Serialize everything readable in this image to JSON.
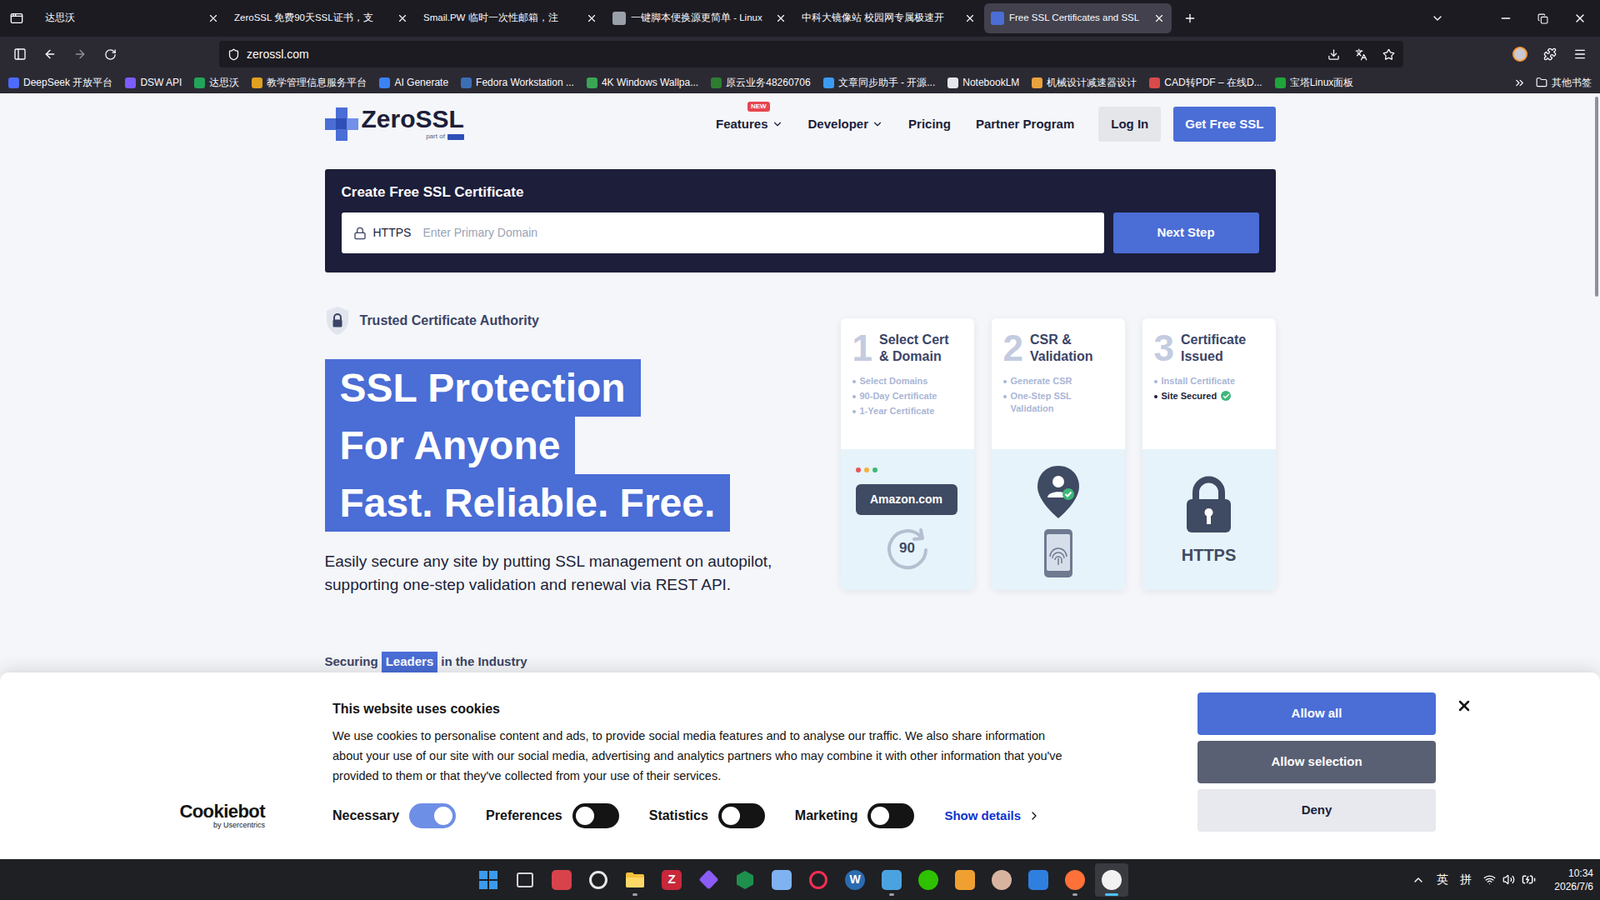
{
  "browser": {
    "tabs": [
      {
        "label": "达思沃",
        "selected": false,
        "has_icon": false
      },
      {
        "label": "ZeroSSL 免费90天SSL证书，支",
        "selected": false,
        "has_icon": false
      },
      {
        "label": "Smail.PW 临时一次性邮箱，注",
        "selected": false,
        "has_icon": false
      },
      {
        "label": "一键脚本便换源更简单 - Linux",
        "selected": false,
        "has_icon": true,
        "color": "#9aa0aa"
      },
      {
        "label": "中科大镜像站 校园网专属极速开",
        "selected": false,
        "has_icon": false
      },
      {
        "label": "Free SSL Certificates and SSL",
        "selected": true,
        "has_icon": true,
        "color": "#4a6dd6"
      }
    ],
    "address": "zerossl.com",
    "bookmarks": [
      {
        "label": "DeepSeek 开放平台",
        "color": "#4d6bfe"
      },
      {
        "label": "DSW API",
        "color": "#7c5cff"
      },
      {
        "label": "达思沃",
        "color": "#22a55a"
      },
      {
        "label": "教学管理信息服务平台",
        "color": "#e0a020"
      },
      {
        "label": "AI Generate",
        "color": "#3b82f6"
      },
      {
        "label": "Fedora Workstation ...",
        "color": "#3c6eb4"
      },
      {
        "label": "4K Windows Wallpa...",
        "color": "#3aa655"
      },
      {
        "label": "原云业务48260706",
        "color": "#2e7d32"
      },
      {
        "label": "文章同步助手 - 开源...",
        "color": "#3b9cf6"
      },
      {
        "label": "NotebookLM",
        "color": "#e5e7eb"
      },
      {
        "label": "机械设计减速器设计",
        "color": "#e8a33d"
      },
      {
        "label": "CAD转PDF – 在线D...",
        "color": "#d94a4a"
      },
      {
        "label": "宝塔Linux面板",
        "color": "#20a53a"
      }
    ],
    "other_bookmarks": "其他书签"
  },
  "page": {
    "logo": {
      "name": "ZeroSSL",
      "tagline": "part of"
    },
    "nav": [
      {
        "label": "Features",
        "badge": "NEW",
        "dropdown": true
      },
      {
        "label": "Developer",
        "dropdown": true
      },
      {
        "label": "Pricing",
        "dropdown": false
      },
      {
        "label": "Partner Program",
        "dropdown": false
      }
    ],
    "login": "Log In",
    "cta": "Get Free SSL",
    "create": {
      "title": "Create Free SSL Certificate",
      "prefix": "HTTPS",
      "placeholder": "Enter Primary Domain",
      "button": "Next Step"
    },
    "trusted": "Trusted Certificate Authority",
    "headline": [
      "SSL Protection",
      "For Anyone",
      "Fast. Reliable. Free."
    ],
    "intro": [
      "Easily secure any site by putting SSL management on autopilot,",
      "supporting one-step validation and renewal via REST API."
    ],
    "steps": [
      {
        "number": "1",
        "title": [
          "Select Cert",
          "& Domain"
        ],
        "kind": "domain",
        "items": [
          {
            "text": "Select Domains",
            "done": false
          },
          {
            "text": "90-Day Certificate",
            "done": false
          },
          {
            "text": "1-Year Certificate",
            "done": false
          }
        ],
        "domain": "Amazon.com",
        "days": "90"
      },
      {
        "number": "2",
        "title": [
          "CSR &",
          "Validation"
        ],
        "kind": "validation",
        "items": [
          {
            "text": "Generate CSR",
            "done": false
          },
          {
            "text": "One-Step SSL Validation",
            "done": false
          }
        ]
      },
      {
        "number": "3",
        "title": [
          "Certificate",
          "Issued"
        ],
        "kind": "issued",
        "items": [
          {
            "text": "Install Certificate",
            "done": false
          },
          {
            "text": "Site Secured",
            "done": true
          }
        ],
        "protocol": "HTTPS"
      }
    ],
    "leaders": {
      "before": "Securing",
      "highlight": "Leaders",
      "after": "in the Industry"
    }
  },
  "cookie_banner": {
    "title": "This website uses cookies",
    "lines": [
      "We use cookies to personalise content and ads, to provide social media features and to analyse our traffic. We also share information",
      "about your use of our site with our social media, advertising and analytics partners who may combine it with other information that you've",
      "provided to them or that they've collected from your use of their services."
    ],
    "brand": "Cookiebot",
    "brand_sub": "by Usercentrics",
    "toggles": [
      {
        "label": "Necessary",
        "on": true,
        "disabled": true
      },
      {
        "label": "Preferences",
        "on": false,
        "disabled": false
      },
      {
        "label": "Statistics",
        "on": false,
        "disabled": false
      },
      {
        "label": "Marketing",
        "on": false,
        "disabled": false
      }
    ],
    "details": "Show details",
    "buttons": [
      {
        "label": "Allow all",
        "kind": "primary"
      },
      {
        "label": "Allow selection",
        "kind": "secondary"
      },
      {
        "label": "Deny",
        "kind": "plain"
      }
    ]
  },
  "taskbar": {
    "apps": [
      {
        "kind": "windows",
        "color": "#3a9bf0",
        "running": false,
        "active": false
      },
      {
        "kind": "outline",
        "color": "#cfd3da",
        "running": false,
        "active": false
      },
      {
        "kind": "square",
        "color": "#d8424b",
        "running": false,
        "active": false
      },
      {
        "kind": "ring",
        "color": "#e6e6e6",
        "running": false,
        "active": false
      },
      {
        "kind": "folder",
        "color": "#f5c23c",
        "running": true,
        "active": false
      },
      {
        "kind": "glyph",
        "color": "#c8283a",
        "glyph": "Z",
        "running": false,
        "active": false
      },
      {
        "kind": "diamond",
        "color": "#8b5cf6",
        "running": false,
        "active": false
      },
      {
        "kind": "hex",
        "color": "#1f8f4e",
        "running": false,
        "active": false
      },
      {
        "kind": "square",
        "color": "#7fb2f0",
        "running": false,
        "active": false
      },
      {
        "kind": "ring",
        "color": "#fe2c55",
        "running": false,
        "active": false
      },
      {
        "kind": "badge",
        "color": "#2b6cb0",
        "glyph": "W",
        "running": false,
        "active": false
      },
      {
        "kind": "square",
        "color": "#4aa3e0",
        "running": true,
        "active": false
      },
      {
        "kind": "circle",
        "color": "#2dc100",
        "running": false,
        "active": false
      },
      {
        "kind": "square",
        "color": "#f0a030",
        "running": false,
        "active": false
      },
      {
        "kind": "circle",
        "color": "#d8b4a0",
        "running": false,
        "active": false
      },
      {
        "kind": "square",
        "color": "#2f7fe0",
        "running": false,
        "active": false
      },
      {
        "kind": "circle",
        "color": "#ff7139",
        "running": true,
        "active": false
      },
      {
        "kind": "circle",
        "color": "#f2f2f2",
        "running": true,
        "active": true
      }
    ],
    "input_mode": "英",
    "ime": "拼",
    "time": "10:34",
    "date": "2026/7/6"
  }
}
